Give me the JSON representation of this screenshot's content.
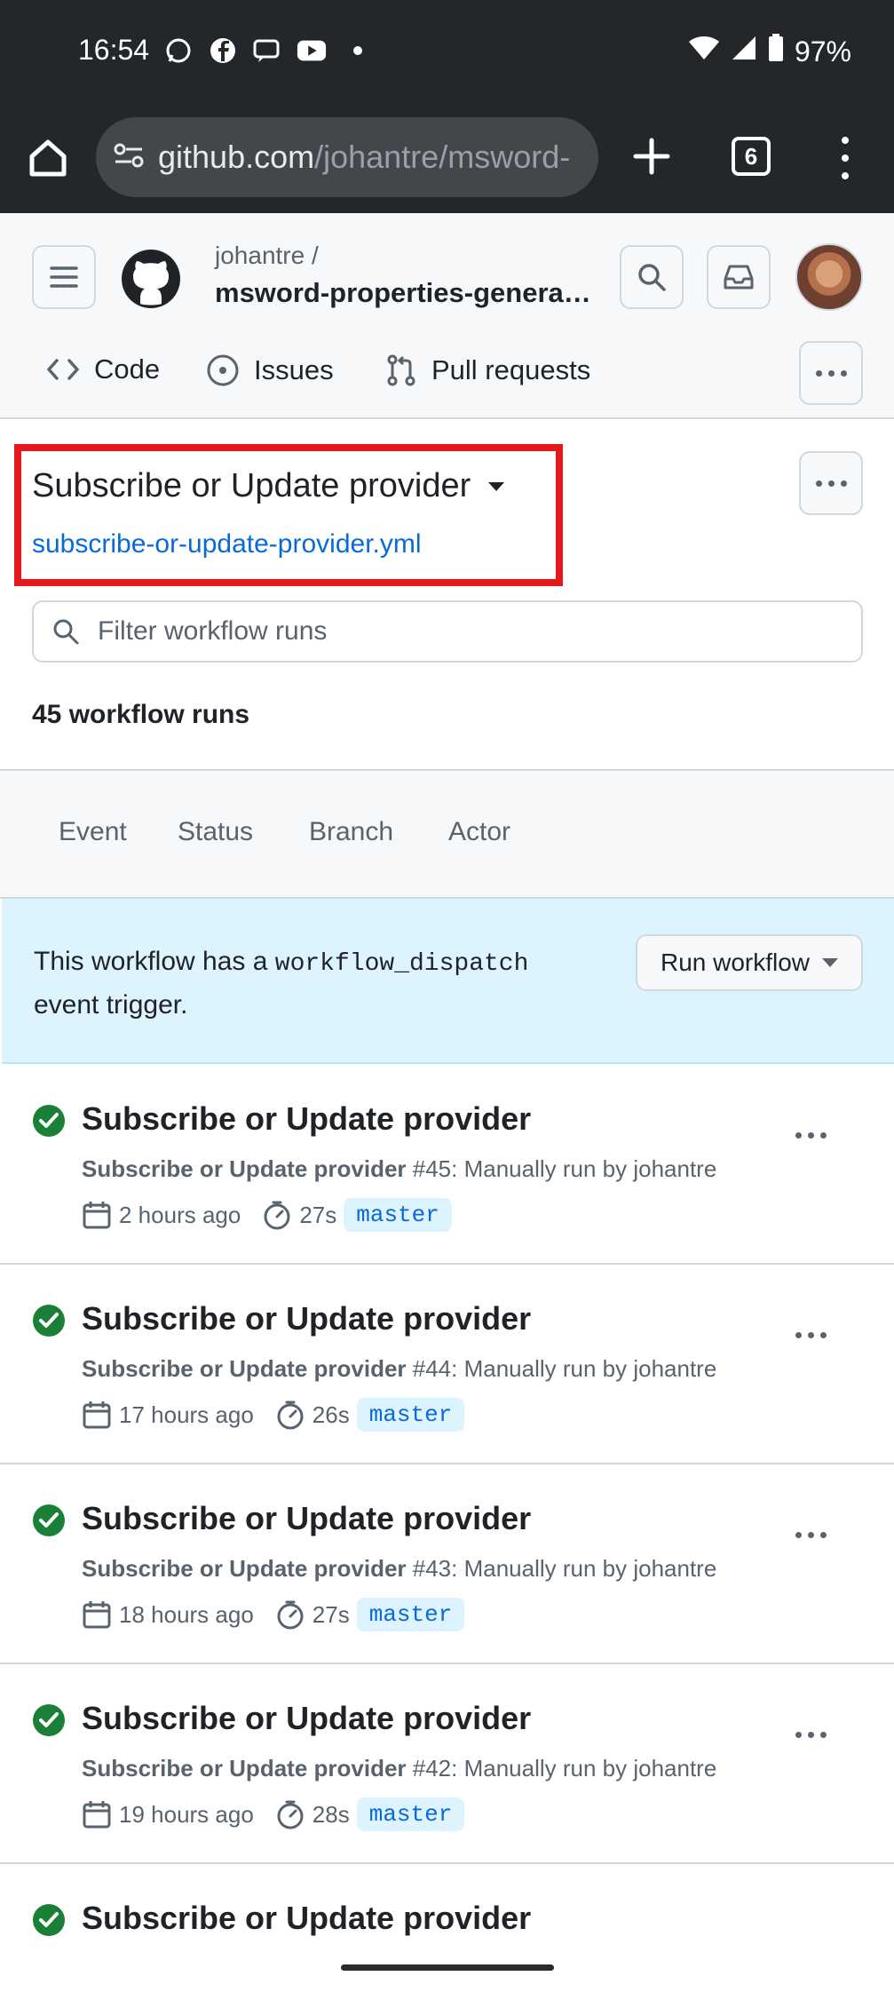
{
  "status_bar": {
    "time": "16:54",
    "battery": "97%"
  },
  "browser": {
    "url_host": "github.com",
    "url_path": "/johantre/msword-",
    "tab_count": "6"
  },
  "repo": {
    "owner": "johantre /",
    "name": "msword-properties-genera…"
  },
  "nav": {
    "tabs": [
      {
        "label": "Code"
      },
      {
        "label": "Issues"
      },
      {
        "label": "Pull requests"
      }
    ]
  },
  "workflow": {
    "title": "Subscribe or Update provider",
    "file": "subscribe-or-update-provider.yml",
    "filter_placeholder": "Filter workflow runs",
    "run_count": "45 workflow runs"
  },
  "filters": [
    {
      "label": "Event"
    },
    {
      "label": "Status"
    },
    {
      "label": "Branch"
    },
    {
      "label": "Actor"
    }
  ],
  "dispatch": {
    "text_before": "This workflow has a ",
    "code": "workflow_dispatch",
    "text_after": "event trigger.",
    "button_label": "Run workflow"
  },
  "runs": [
    {
      "title": "Subscribe or Update provider",
      "workflow": "Subscribe or Update provider",
      "detail": " #45: Manually run by johantre",
      "time": "2 hours ago",
      "duration": "27s",
      "branch": "master"
    },
    {
      "title": "Subscribe or Update provider",
      "workflow": "Subscribe or Update provider",
      "detail": " #44: Manually run by johantre",
      "time": "17 hours ago",
      "duration": "26s",
      "branch": "master"
    },
    {
      "title": "Subscribe or Update provider",
      "workflow": "Subscribe or Update provider",
      "detail": " #43: Manually run by johantre",
      "time": "18 hours ago",
      "duration": "27s",
      "branch": "master"
    },
    {
      "title": "Subscribe or Update provider",
      "workflow": "Subscribe or Update provider",
      "detail": " #42: Manually run by johantre",
      "time": "19 hours ago",
      "duration": "28s",
      "branch": "master"
    },
    {
      "title": "Subscribe or Update provider"
    }
  ],
  "colors": {
    "success": "#1a7f37",
    "link": "#0969da",
    "highlight_box": "#e3191e",
    "dispatch_bg": "#ddf4ff"
  }
}
